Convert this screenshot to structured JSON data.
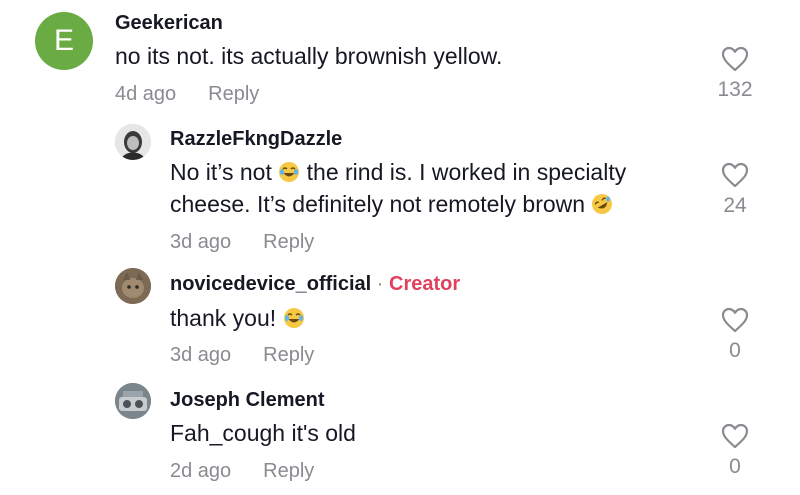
{
  "comments": [
    {
      "avatar_letter": "E",
      "username": "Geekerican",
      "text_lines": [
        "no its not. its actually brownish yellow."
      ],
      "age": "4d ago",
      "reply_label": "Reply",
      "likes": "132"
    },
    {
      "username": "RazzleFkngDazzle",
      "text_lines": [
        "No it’s not",
        "the rind is. I worked in specialty",
        "cheese. It’s definitely not remotely brown"
      ],
      "age": "3d ago",
      "reply_label": "Reply",
      "likes": "24"
    },
    {
      "username": "novicedevice_official",
      "creator_separator": "·",
      "creator_label": "Creator",
      "text_lines": [
        "thank you!"
      ],
      "age": "3d ago",
      "reply_label": "Reply",
      "likes": "0"
    },
    {
      "username": "Joseph Clement",
      "text_lines": [
        "Fah_cough it's old"
      ],
      "age": "2d ago",
      "reply_label": "Reply",
      "likes": "0"
    }
  ],
  "icons": {
    "like": "heart-outline-icon",
    "tears_of_joy": "face-with-tears-of-joy-emoji",
    "rolling_laughing": "rolling-on-floor-laughing-emoji"
  },
  "colors": {
    "creator_accent": "#e0425d",
    "secondary_text": "#8a8b91",
    "avatar_letter_bg": "#6aac43"
  }
}
